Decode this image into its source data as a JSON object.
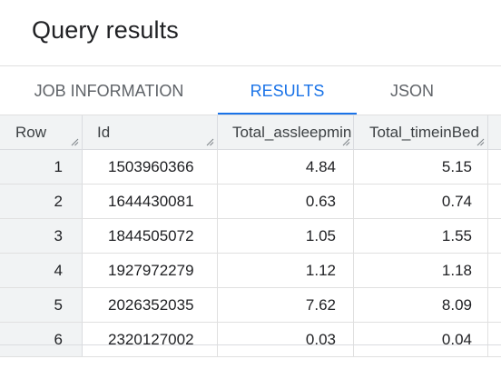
{
  "title": "Query results",
  "tabs": [
    {
      "label": "JOB INFORMATION",
      "active": false
    },
    {
      "label": "RESULTS",
      "active": true
    },
    {
      "label": "JSON",
      "active": false
    }
  ],
  "accent_color": "#1a73e8",
  "table": {
    "columns": [
      "Row",
      "Id",
      "Total_assleepmin",
      "Total_timeinBed"
    ],
    "rows": [
      [
        "1",
        "1503960366",
        "4.84",
        "5.15"
      ],
      [
        "2",
        "1644430081",
        "0.63",
        "0.74"
      ],
      [
        "3",
        "1844505072",
        "1.05",
        "1.55"
      ],
      [
        "4",
        "1927972279",
        "1.12",
        "1.18"
      ],
      [
        "5",
        "2026352035",
        "7.62",
        "8.09"
      ],
      [
        "6",
        "2320127002",
        "0.03",
        "0.04"
      ]
    ]
  },
  "icons": {
    "column_resize": "resize-handle-icon"
  }
}
